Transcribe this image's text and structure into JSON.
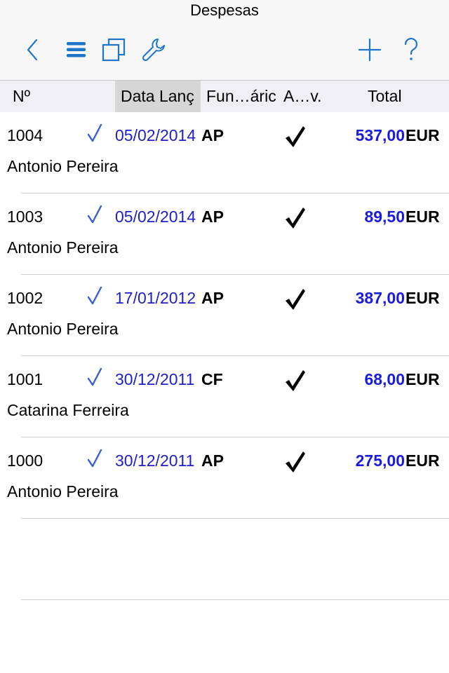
{
  "window": {
    "title": "Despesas"
  },
  "toolbar": {
    "back_icon": "chevron-left-icon",
    "list_icon": "list-icon",
    "copy_icon": "copy-icon",
    "settings_icon": "wrench-icon",
    "add_icon": "plus-icon",
    "help_icon": "question-icon",
    "icon_color": "#1f75c9"
  },
  "columns": {
    "number": "Nº",
    "date": "Data Lanç",
    "employee": "Fun…áric",
    "approved": "A…v.",
    "total": "Total"
  },
  "rows": [
    {
      "number": "1004",
      "checked": true,
      "date": "05/02/2014",
      "employee": "AP",
      "approved": true,
      "total": "537,00",
      "currency": "EUR",
      "name": "Antonio Pereira"
    },
    {
      "number": "1003",
      "checked": true,
      "date": "05/02/2014",
      "employee": "AP",
      "approved": true,
      "total": "89,50",
      "currency": "EUR",
      "name": "Antonio Pereira"
    },
    {
      "number": "1002",
      "checked": true,
      "date": "17/01/2012",
      "employee": "AP",
      "approved": true,
      "total": "387,00",
      "currency": "EUR",
      "name": "Antonio Pereira"
    },
    {
      "number": "1001",
      "checked": true,
      "date": "30/12/2011",
      "employee": "CF",
      "approved": true,
      "total": "68,00",
      "currency": "EUR",
      "name": "Catarina Ferreira"
    },
    {
      "number": "1000",
      "checked": true,
      "date": "30/12/2011",
      "employee": "AP",
      "approved": true,
      "total": "275,00",
      "currency": "EUR",
      "name": "Antonio Pereira"
    }
  ],
  "colors": {
    "date": "#2020c8",
    "total": "#1b1be0",
    "check": "#3a5fcd",
    "approved": "#000000"
  }
}
